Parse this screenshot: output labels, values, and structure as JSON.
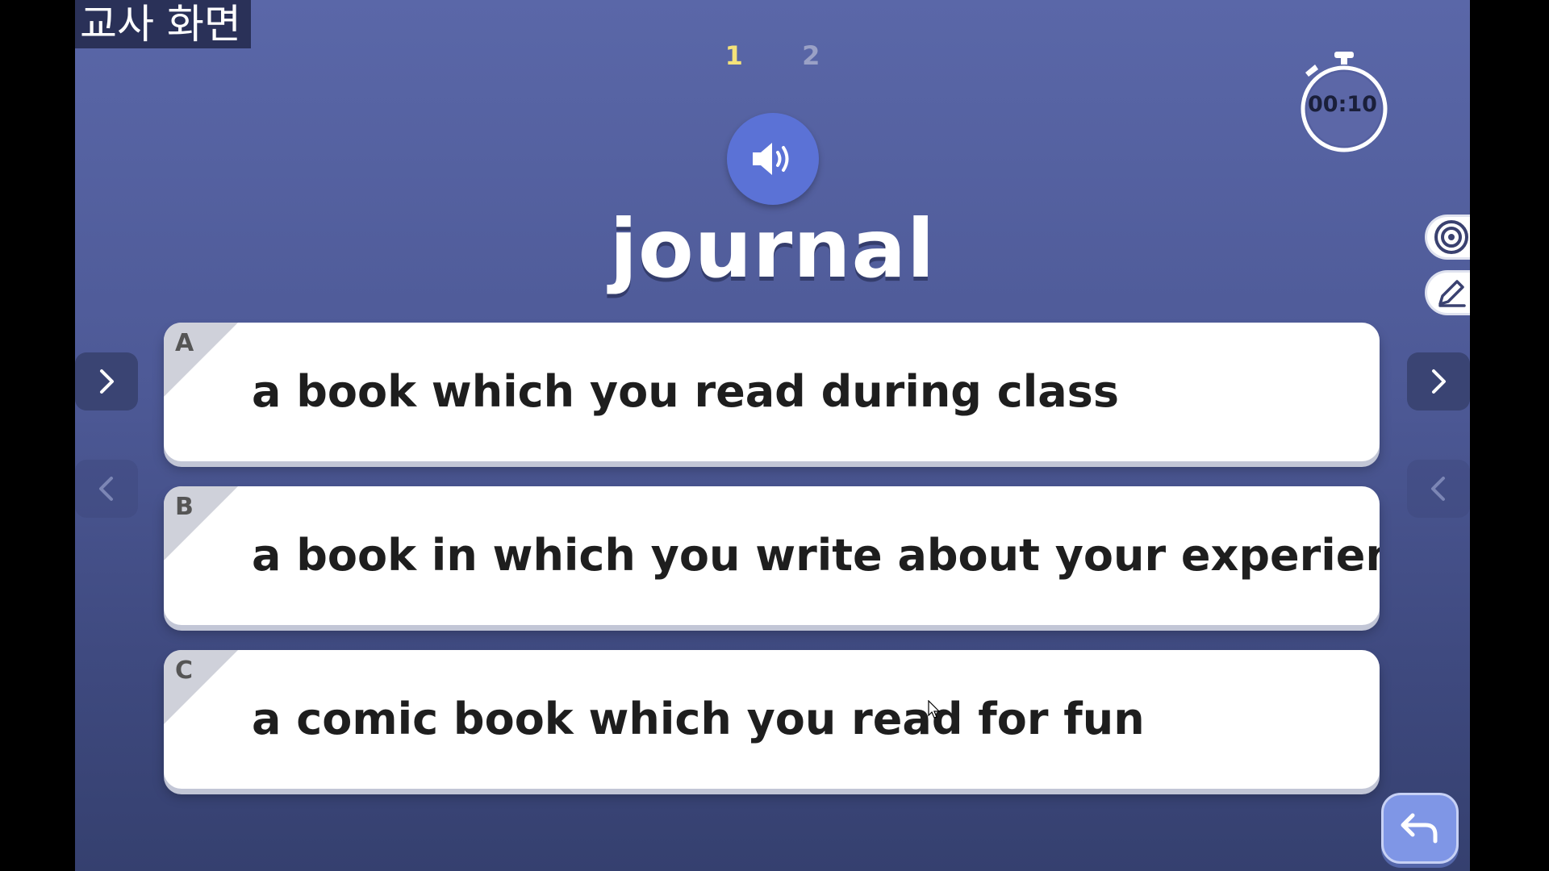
{
  "overlay": {
    "label": "교사 화면"
  },
  "pagination": {
    "pages": [
      "1",
      "2"
    ],
    "current": "1"
  },
  "timer": {
    "display": "00:10"
  },
  "question": {
    "word": "journal"
  },
  "options": [
    {
      "letter": "A",
      "text": "a book which you read during class"
    },
    {
      "letter": "B",
      "text": "a book in which you write about your experiences"
    },
    {
      "letter": "C",
      "text": "a comic book which you read for fun"
    }
  ],
  "icons": {
    "sound": "speaker-icon",
    "timer": "stopwatch-icon",
    "target": "target-icon",
    "pencil": "pencil-icon",
    "next": "chevron-right-icon",
    "prev": "chevron-left-icon",
    "back": "return-arrow-icon"
  },
  "colors": {
    "background_top": "#5a67a8",
    "background_bottom": "#35406f",
    "sound_button": "#5b72d6",
    "active_page": "#f4e27a",
    "back_button": "#7f96e6"
  }
}
